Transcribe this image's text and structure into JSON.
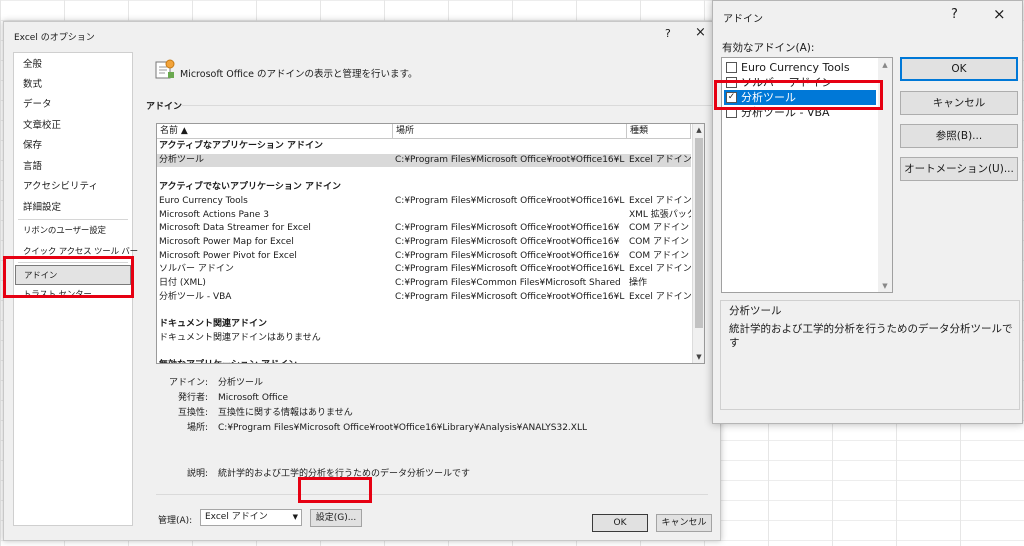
{
  "options_dialog": {
    "title": "Excel のオプション",
    "help": "?",
    "close": "×",
    "nav": [
      "全般",
      "数式",
      "データ",
      "文章校正",
      "保存",
      "言語",
      "アクセシビリティ",
      "詳細設定",
      "リボンのユーザー設定",
      "クイック アクセス ツール バー",
      "アドイン",
      "トラスト センター"
    ],
    "header_text": "Microsoft Office のアドインの表示と管理を行います。",
    "section_title": "アドイン",
    "columns": [
      "名前 ▲",
      "場所",
      "種類"
    ],
    "rows": [
      {
        "kind": "group",
        "name": "アクティブなアプリケーション アドイン"
      },
      {
        "kind": "item",
        "name": "分析ツール",
        "loc": "C:¥Program Files¥Microsoft Office¥root¥Office16¥L",
        "type": "Excel アドイン",
        "active": true
      },
      {
        "kind": "blank"
      },
      {
        "kind": "group",
        "name": "アクティブでないアプリケーション アドイン"
      },
      {
        "kind": "item",
        "name": "Euro Currency Tools",
        "loc": "C:¥Program Files¥Microsoft Office¥root¥Office16¥L",
        "type": "Excel アドイン"
      },
      {
        "kind": "item",
        "name": "Microsoft Actions Pane 3",
        "loc": "",
        "type": "XML 拡張パック"
      },
      {
        "kind": "item",
        "name": "Microsoft Data Streamer for Excel",
        "loc": "C:¥Program Files¥Microsoft Office¥root¥Office16¥",
        "type": "COM アドイン"
      },
      {
        "kind": "item",
        "name": "Microsoft Power Map for Excel",
        "loc": "C:¥Program Files¥Microsoft Office¥root¥Office16¥",
        "type": "COM アドイン"
      },
      {
        "kind": "item",
        "name": "Microsoft Power Pivot for Excel",
        "loc": "C:¥Program Files¥Microsoft Office¥root¥Office16¥",
        "type": "COM アドイン"
      },
      {
        "kind": "item",
        "name": "ソルバー アドイン",
        "loc": "C:¥Program Files¥Microsoft Office¥root¥Office16¥L",
        "type": "Excel アドイン"
      },
      {
        "kind": "item",
        "name": "日付 (XML)",
        "loc": "C:¥Program Files¥Common Files¥Microsoft Shared",
        "type": "操作"
      },
      {
        "kind": "item",
        "name": "分析ツール - VBA",
        "loc": "C:¥Program Files¥Microsoft Office¥root¥Office16¥L",
        "type": "Excel アドイン"
      },
      {
        "kind": "blank"
      },
      {
        "kind": "group",
        "name": "ドキュメント関連アドイン"
      },
      {
        "kind": "item",
        "name": " ドキュメント関連アドインはありません",
        "loc": "",
        "type": ""
      },
      {
        "kind": "blank"
      },
      {
        "kind": "group",
        "name": "無効なアプリケーション アドイン"
      }
    ],
    "details": [
      {
        "label": "アドイン:",
        "value": "分析ツール"
      },
      {
        "label": "発行者:",
        "value": "Microsoft Office"
      },
      {
        "label": "互換性:",
        "value": "互換性に関する情報はありません"
      },
      {
        "label": "場所:",
        "value": "C:¥Program Files¥Microsoft Office¥root¥Office16¥Library¥Analysis¥ANALYS32.XLL"
      },
      {
        "label": "",
        "value": ""
      },
      {
        "label": "説明:",
        "value": "統計学的および工学的分析を行うためのデータ分析ツールです"
      }
    ],
    "manage_label": "管理(A):",
    "manage_value": "Excel アドイン",
    "go_button": "設定(G)...",
    "ok": "OK",
    "cancel": "キャンセル"
  },
  "addins_dialog": {
    "title": "アドイン",
    "help": "?",
    "close": "×",
    "list_label": "有効なアドイン(A):",
    "items": [
      {
        "name": "Euro Currency Tools",
        "checked": false
      },
      {
        "name": "ソルバー アドイン",
        "checked": false
      },
      {
        "name": "分析ツール",
        "checked": true,
        "selected": true
      },
      {
        "name": "分析ツール - VBA",
        "checked": false
      }
    ],
    "buttons": [
      "OK",
      "キャンセル",
      "参照(B)...",
      "オートメーション(U)..."
    ],
    "desc_title": "分析ツール",
    "desc_text": "統計学的および工学的分析を行うためのデータ分析ツールです"
  },
  "highlight_color": "#e60012"
}
